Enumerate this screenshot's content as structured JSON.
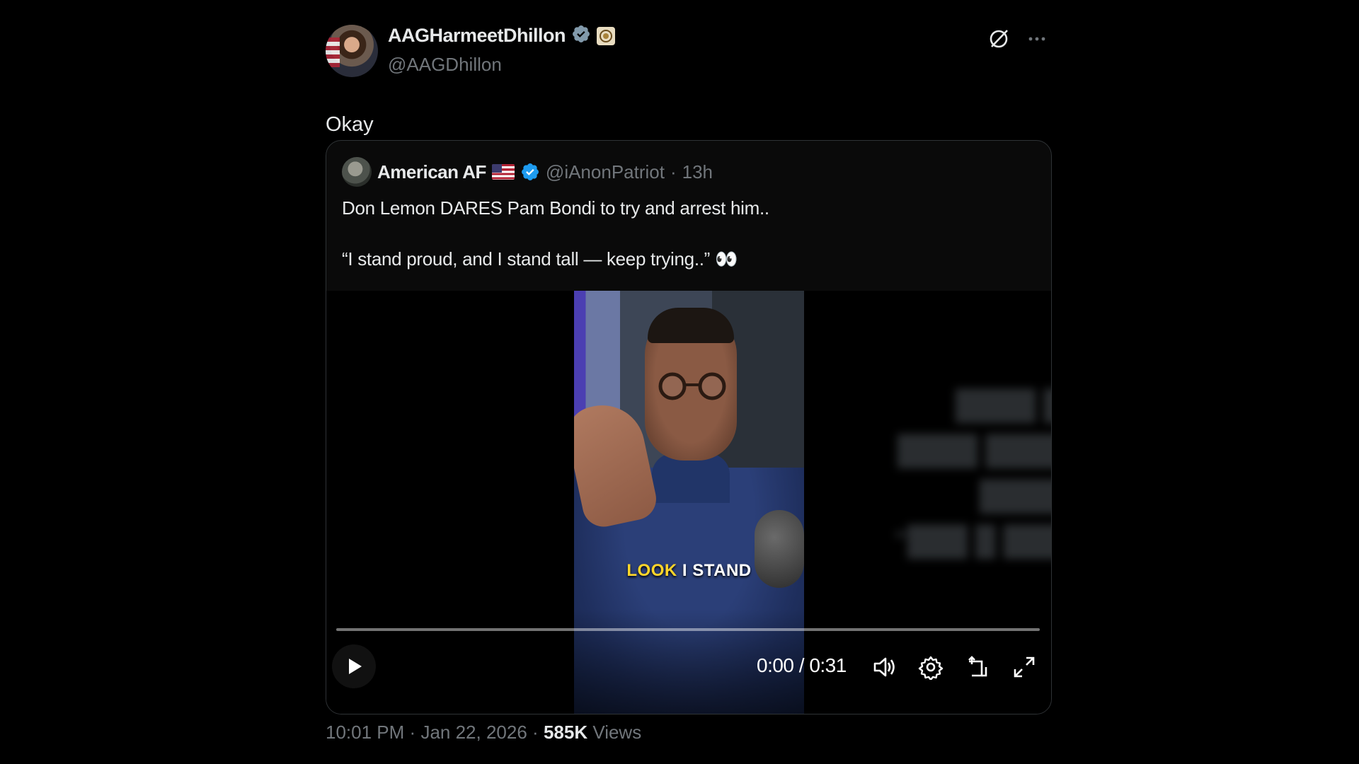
{
  "author": {
    "display_name": "AAGHarmeetDhillon",
    "handle": "@AAGDhillon"
  },
  "tweet": {
    "text": "Okay",
    "time": "10:01 PM",
    "date": "Jan 22, 2026",
    "separator": "·",
    "views_count": "585K",
    "views_label": "Views"
  },
  "quoted": {
    "display_name": "American AF",
    "handle": "@iAnonPatriot",
    "separator": "·",
    "time": "13h",
    "line1": "Don Lemon DARES Pam Bondi to try and arrest him..",
    "line2": "“I stand proud, and I stand tall — keep trying..” 👀",
    "video": {
      "caption_word1": "LOOK",
      "caption_word2": "I STAND",
      "current_time": "0:00",
      "duration": "0:31",
      "time_display": "0:00 / 0:31",
      "progress": 0
    }
  },
  "icons": {
    "verified": "verified-badge-icon",
    "affiliate": "affiliate-badge-icon",
    "grok": "grok-icon",
    "more": "more-icon",
    "flag": "us-flag-icon",
    "play": "play-icon",
    "volume": "volume-icon",
    "settings": "settings-icon",
    "pip": "pip-icon",
    "fullscreen": "fullscreen-icon"
  },
  "colors": {
    "background": "#000000",
    "text": "#e7e9ea",
    "muted": "#71767b",
    "verified": "#1d9bf0",
    "caption_yellow": "#ffd62a"
  }
}
